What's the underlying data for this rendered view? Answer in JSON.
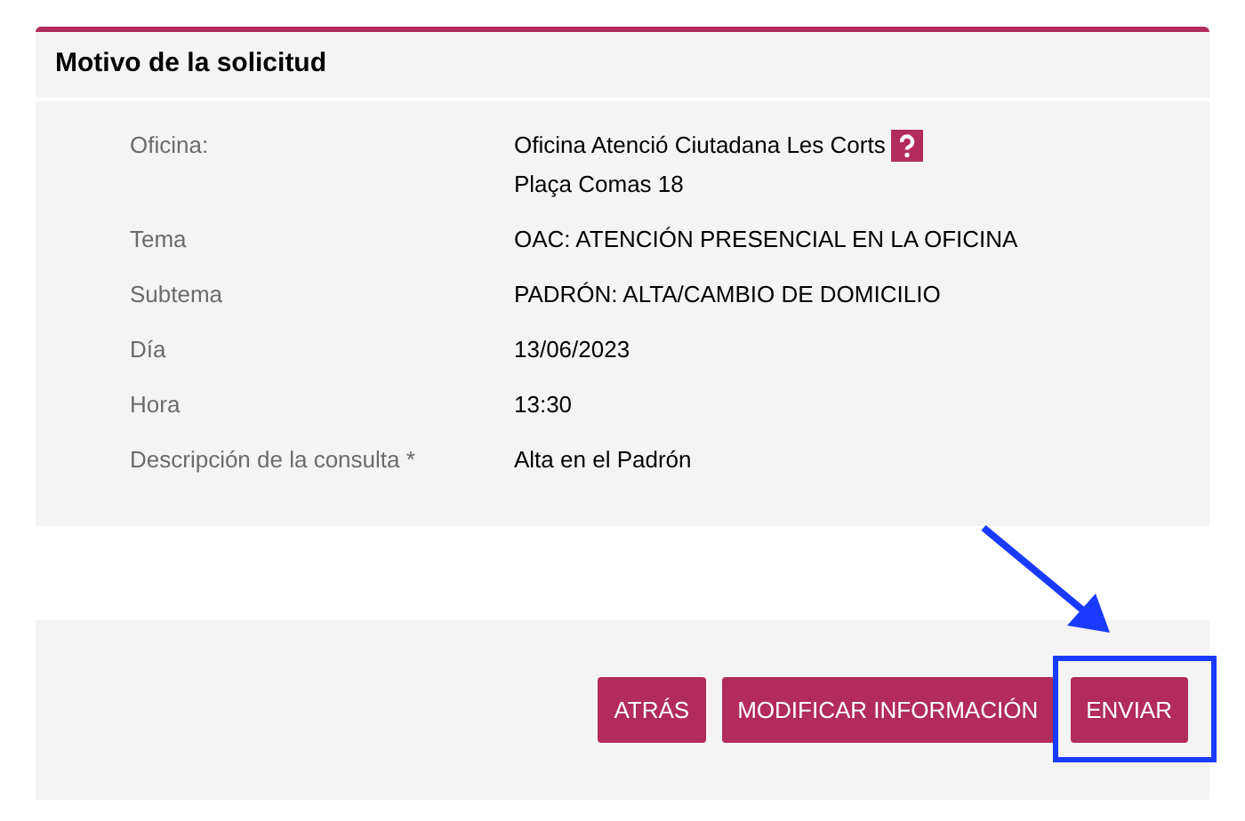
{
  "section": {
    "title": "Motivo de la solicitud"
  },
  "fields": [
    {
      "label": "Oficina:",
      "lines": [
        "Oficina Atenció Ciutadana Les Corts",
        "Plaça Comas 18"
      ],
      "help": true
    },
    {
      "label": "Tema",
      "lines": [
        "OAC: ATENCIÓN PRESENCIAL EN LA OFICINA"
      ]
    },
    {
      "label": "Subtema",
      "lines": [
        "PADRÓN: ALTA/CAMBIO DE DOMICILIO"
      ]
    },
    {
      "label": "Día",
      "lines": [
        "13/06/2023"
      ]
    },
    {
      "label": "Hora",
      "lines": [
        "13:30"
      ]
    },
    {
      "label": "Descripción de la consulta *",
      "lines": [
        "Alta en el Padrón"
      ]
    }
  ],
  "buttons": [
    {
      "label": "ATRÁS"
    },
    {
      "label": "MODIFICAR INFORMACIÓN"
    },
    {
      "label": "ENVIAR",
      "highlighted": true
    }
  ]
}
